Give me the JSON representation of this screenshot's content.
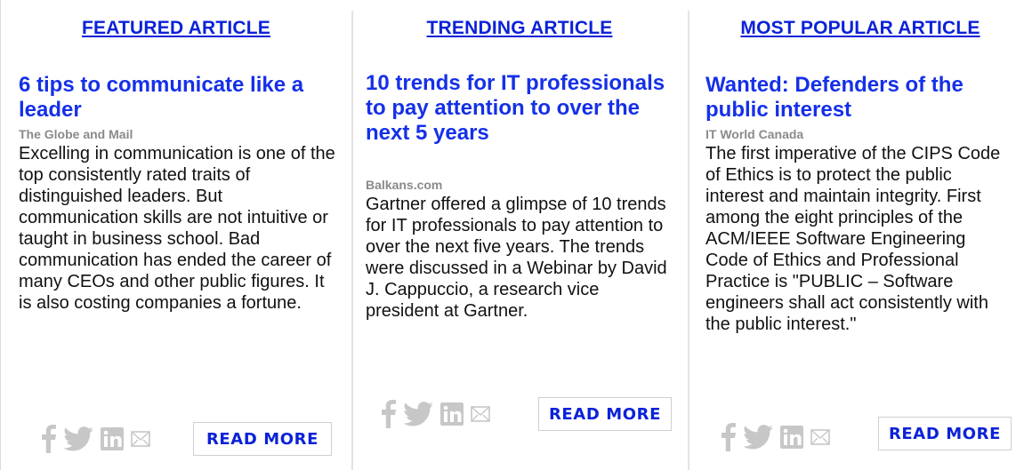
{
  "articles": [
    {
      "section_label": "FEATURED ARTICLE",
      "title": "6 tips to communicate like a leader",
      "source": "The Globe and Mail",
      "summary": "Excelling in communication is one of the top consistently rated traits of distinguished leaders. But communication skills are not intuitive or taught in business school. Bad communication has ended the career of many CEOs and other public figures. It is also costing companies a fortune.",
      "read_more": "READ MORE"
    },
    {
      "section_label": "TRENDING ARTICLE",
      "title": "10 trends for IT professionals to pay attention to over the next 5 years",
      "source": "Balkans.com",
      "summary": "Gartner offered a glimpse of 10 trends for IT professionals to pay attention to over the next five years. The trends were discussed in a Webinar by David J. Cappuccio, a research vice president at Gartner.",
      "read_more": "READ MORE"
    },
    {
      "section_label": "MOST POPULAR ARTICLE",
      "title": "Wanted: Defenders of the public interest",
      "source": "IT World Canada",
      "summary": "The first imperative of the CIPS Code of Ethics is to protect the public interest and maintain integrity. First among the eight principles of the ACM/IEEE Software Engineering Code of Ethics and Professional Practice is \"PUBLIC – Software engineers shall act consistently with the public interest.\"",
      "read_more": "READ MORE"
    }
  ],
  "share_icons": [
    "facebook-icon",
    "twitter-icon",
    "linkedin-icon",
    "email-icon"
  ],
  "colors": {
    "link": "#0b22d8",
    "title": "#1530e8",
    "source": "#8a8a8a",
    "icon": "#c2c2c2",
    "text": "#111111"
  }
}
